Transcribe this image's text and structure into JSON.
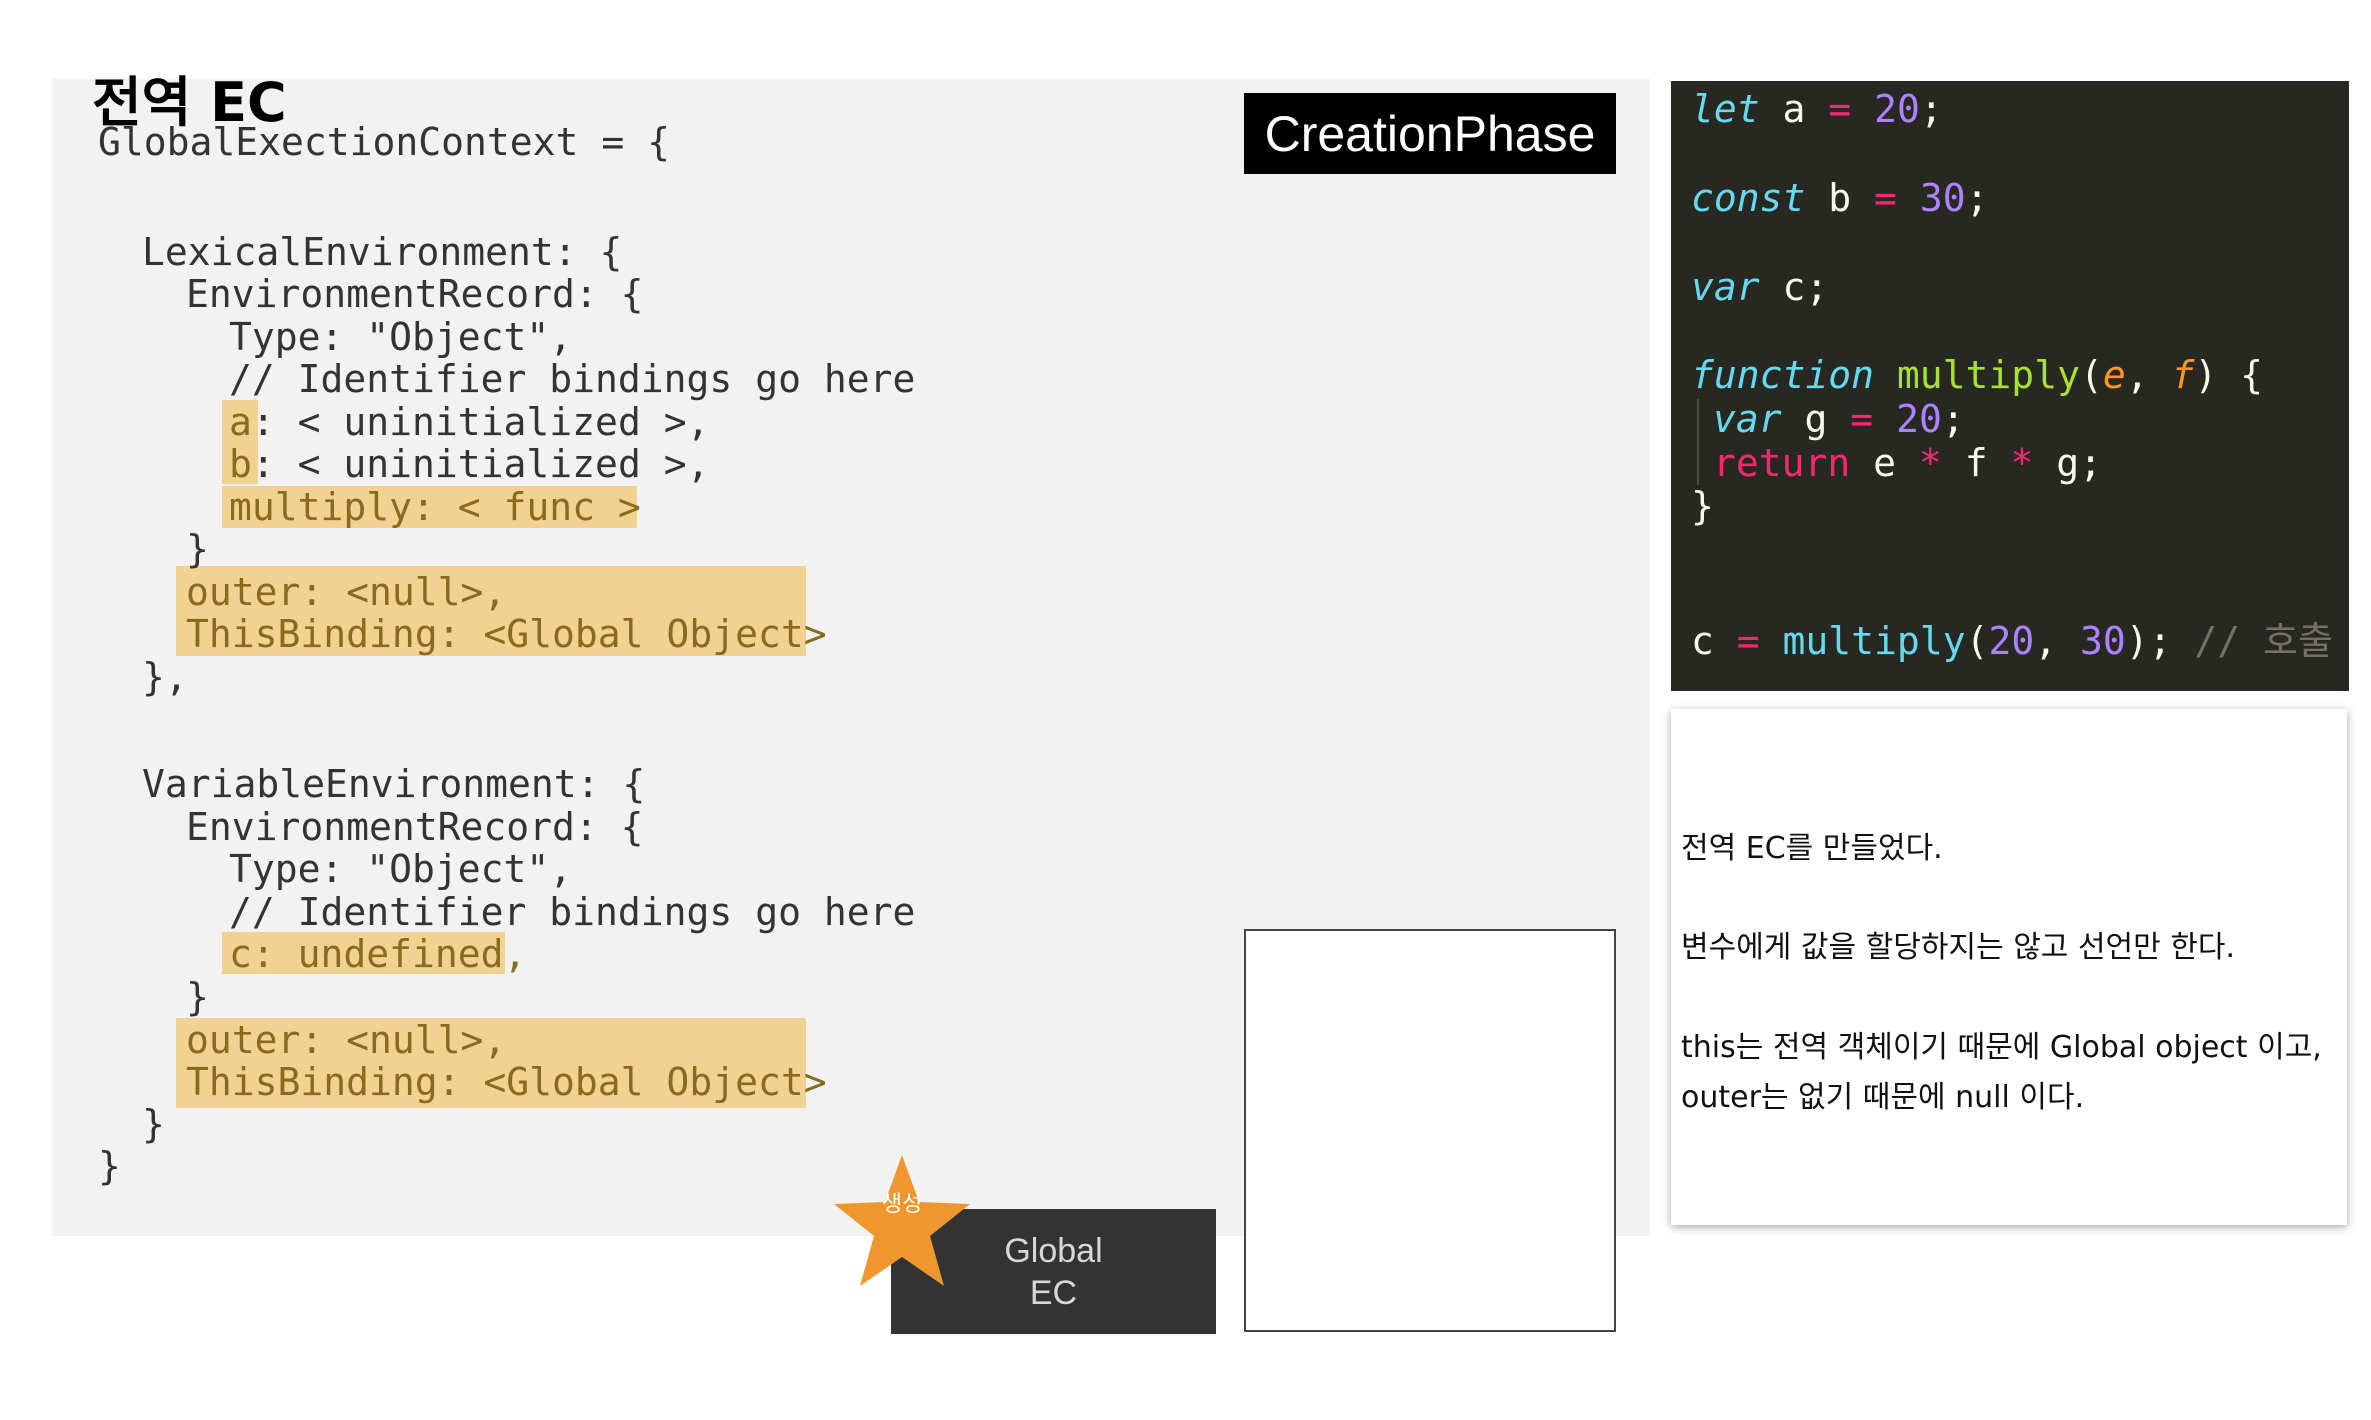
{
  "slide": {
    "title": "전역 EC",
    "phase": "CreationPhase"
  },
  "ec_code": {
    "line_open": "GlobalExectionContext = {",
    "lex_open": "LexicalEnvironment: {",
    "lex_rec_open": "EnvironmentRecord: {",
    "lex_type": "Type: \"Object\",",
    "lex_comment": "// Identifier bindings go here",
    "lex_a_name": "a",
    "lex_a_rest": ": < uninitialized >,",
    "lex_b_name": "b",
    "lex_b_rest": ": < uninitialized >,",
    "lex_multiply": "multiply: < func >",
    "lex_rec_close": "}",
    "lex_outer": "outer: <null>,",
    "lex_this": "ThisBinding: <Global Object>",
    "lex_close": "},",
    "var_open": "VariableEnvironment: {",
    "var_rec_open": "EnvironmentRecord: {",
    "var_type": "Type: \"Object\",",
    "var_comment": "// Identifier bindings go here",
    "var_c": "c: undefined,",
    "var_rec_close": "}",
    "var_outer": "outer: <null>,",
    "var_this": "ThisBinding: <Global Object>",
    "var_close": "}",
    "line_close": "}"
  },
  "stack": {
    "star_label": "생성",
    "frame_line1": "Global",
    "frame_line2": "EC"
  },
  "source": {
    "let": "let",
    "a": " a ",
    "const": "const",
    "b": " b ",
    "var": "var",
    "c_decl": " c;",
    "function": "function",
    "fname": "multiply",
    "p_e": "e",
    "p_f": "f",
    "var_g": "var",
    "g": " g ",
    "ret": "return",
    "ret_expr_e": " e ",
    "ret_expr_f": " f ",
    "ret_expr_g": " g;",
    "close": "}",
    "c_assign": "c ",
    "call_fn": "multiply",
    "n20": "20",
    "n30": "30",
    "comment": "// 호출",
    "eq": "=",
    "star_op": "*"
  },
  "notes": [
    "전역 EC를 만들었다.",
    "변수에게 값을 할당하지는 않고 선언만 한다.",
    "this는 전역 객체이기 때문에 Global object 이고,",
    "outer는 없기 때문에 null 이다."
  ],
  "colors": {
    "highlight": "#f2d291",
    "editor_bg": "#272822",
    "star": "#f0962f"
  }
}
